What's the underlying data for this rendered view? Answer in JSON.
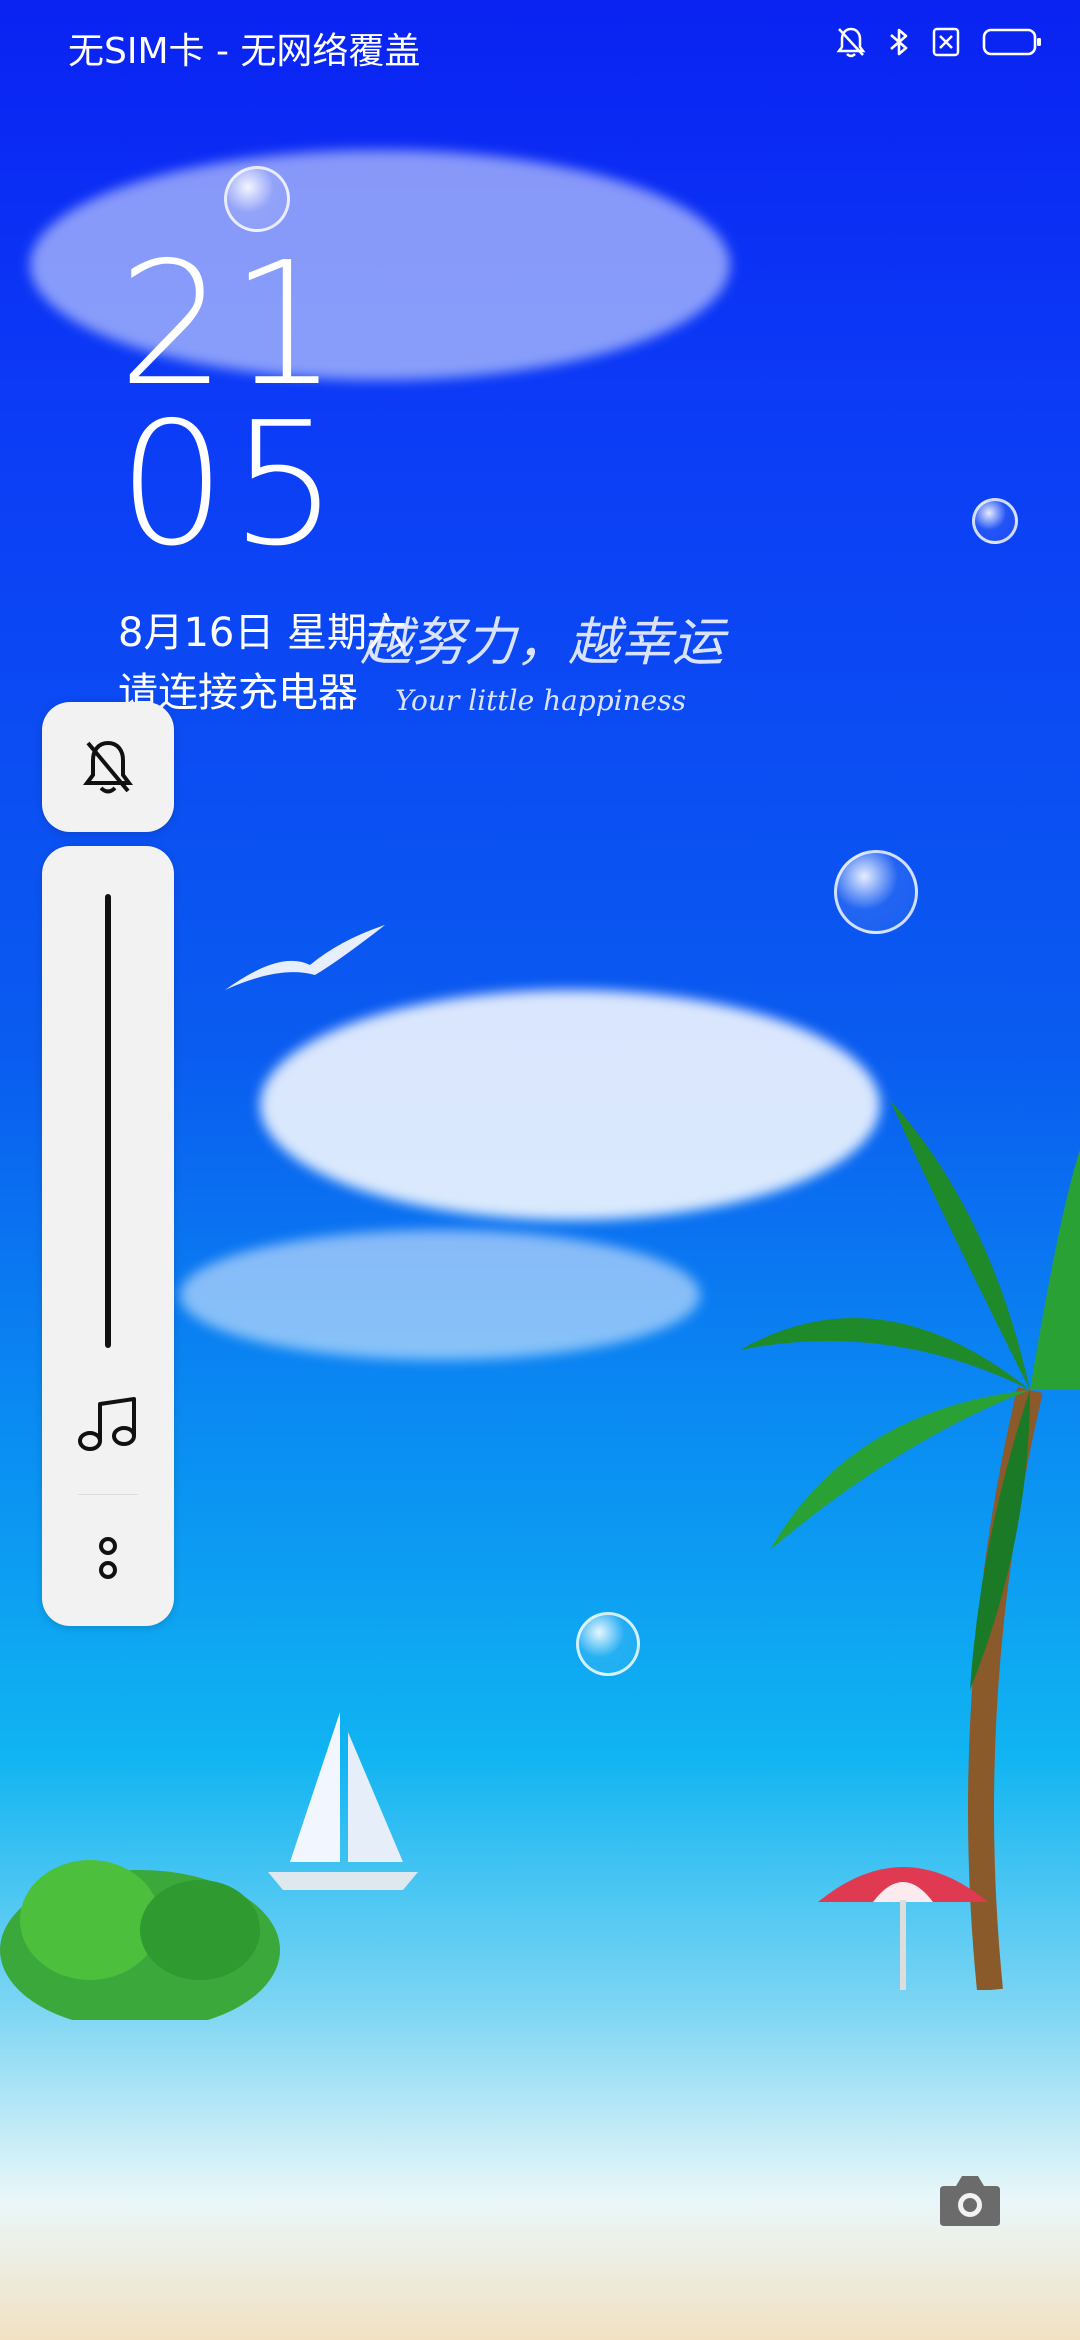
{
  "status_bar": {
    "carrier": "无SIM卡 - 无网络覆盖"
  },
  "lockscreen": {
    "hour": "21",
    "minute": "05",
    "date": "8月16日  星期六",
    "charge_message": "请连接充电器",
    "slogan": "越努力，越幸运",
    "slogan_en": "Your little happiness"
  },
  "icons": {
    "mute": "bell-off-icon",
    "bluetooth": "bluetooth-icon",
    "sim": "no-sim-icon",
    "battery": "battery-icon",
    "music": "music-note-icon",
    "more": "more-dots-icon",
    "camera": "camera-icon"
  }
}
